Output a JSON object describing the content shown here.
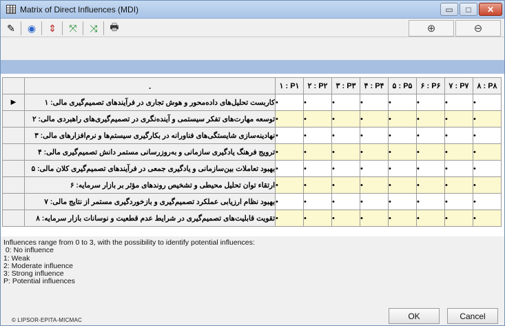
{
  "window": {
    "title": "Matrix of Direct Influences (MDI)",
    "controls": {
      "minimize": "▭",
      "maximize": "□",
      "close": "✕"
    }
  },
  "toolbar": {
    "buttons": [
      "pencil-icon",
      "sphere-icon",
      "arrows-up-down-icon",
      "arrows-in-icon",
      "arrows-out-icon",
      "printer-icon"
    ],
    "glyphs": [
      "✎",
      "◉",
      "⇕",
      "⤧",
      "⤨",
      "🖶"
    ],
    "zoom_in": "⊕",
    "zoom_out": "⊖"
  },
  "matrix": {
    "corner_header": ".",
    "columns": [
      "۱ : P۱",
      "۲ : P۲",
      "۳ : P۳",
      "۴ : P۴",
      "۵ : P۵",
      "۶ : P۶",
      "۷ : P۷",
      "۸ : P۸"
    ],
    "rows": [
      {
        "label": "کاربست تحلیل‌های داده‌محور و هوش تجاری در فرآیندهای تصمیم‌گیری مالی: ۱",
        "selected": true
      },
      {
        "label": "توسعه مهارت‌های تفکر سیستمی و آینده‌نگری در تصمیم‌گیری‌های راهبردی مالی: ۲",
        "selected": false
      },
      {
        "label": "نهادینه‌سازی شایستگی‌های فناورانه در بکارگیری سیستم‌ها و نرم‌افزارهای مالی: ۳",
        "selected": false
      },
      {
        "label": "ترویج فرهنگ یادگیری سازمانی و به‌روزرسانی مستمر دانش تصمیم‌گیری مالی: ۴",
        "selected": false
      },
      {
        "label": "بهبود تعاملات بین‌سازمانی و یادگیری جمعی در فرآیندهای تصمیم‌گیری کلان مالی: ۵",
        "selected": false
      },
      {
        "label": "ارتقاء توان تحلیل محیطی و تشخیص روندهای مؤثر بر بازار سرمایه: ۶",
        "selected": false
      },
      {
        "label": "بهبود نظام ارزیابی عملکرد تصمیم‌گیری و بازخوردگیری مستمر از نتایج مالی: ۷",
        "selected": false
      },
      {
        "label": "تقویت قابلیت‌های تصمیم‌گیری در شرایط عدم قطعیت و نوسانات بازار سرمایه: ۸",
        "selected": false
      }
    ],
    "cell_value": "•",
    "selected_marker": "▶"
  },
  "legend": [
    "Influences range from 0 to 3, with the possibility to identify potential influences:",
    " 0: No influence",
    "1: Weak",
    "2: Moderate influence",
    "3: Strong influence",
    "P: Potential influences"
  ],
  "footer": {
    "copyright": "© LIPSOR-EPITA-MICMAC",
    "ok": "OK",
    "cancel": "Cancel"
  },
  "colors": {
    "title_bar": "#b6cdea",
    "band": "#a7bfe1",
    "even_row": "#fcf8cf",
    "close_button": "#c8472d"
  }
}
